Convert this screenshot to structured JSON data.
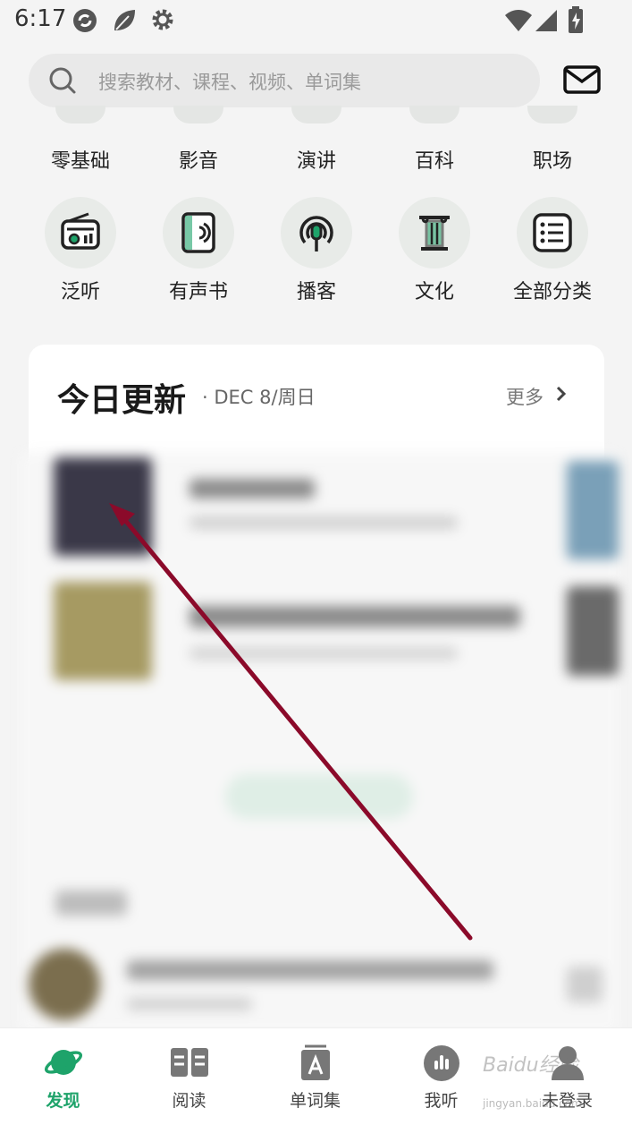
{
  "status_bar": {
    "time": "6:17"
  },
  "search": {
    "placeholder": "搜索教材、课程、视频、单词集"
  },
  "categories_row1": [
    "零基础",
    "影音",
    "演讲",
    "百科",
    "职场"
  ],
  "categories_row2": [
    {
      "label": "泛听",
      "icon": "radio-icon"
    },
    {
      "label": "有声书",
      "icon": "audiobook-icon"
    },
    {
      "label": "播客",
      "icon": "podcast-icon"
    },
    {
      "label": "文化",
      "icon": "pillar-icon"
    },
    {
      "label": "全部分类",
      "icon": "list-icon"
    }
  ],
  "today_card": {
    "title": "今日更新",
    "date": "· DEC 8/周日",
    "more": "更多"
  },
  "tabs": [
    {
      "label": "发现",
      "icon": "planet-icon",
      "active": true
    },
    {
      "label": "阅读",
      "icon": "book-icon",
      "active": false
    },
    {
      "label": "单词集",
      "icon": "word-card-icon",
      "active": false
    },
    {
      "label": "我听",
      "icon": "audio-bars-icon",
      "active": false
    },
    {
      "label": "未登录",
      "icon": "user-icon",
      "active": false
    }
  ],
  "watermark": {
    "text": "Baidu经验",
    "sub": "jingyan.baidu.com"
  },
  "colors": {
    "accent": "#1ea36a",
    "annotation_arrow": "#8b0a2a"
  }
}
